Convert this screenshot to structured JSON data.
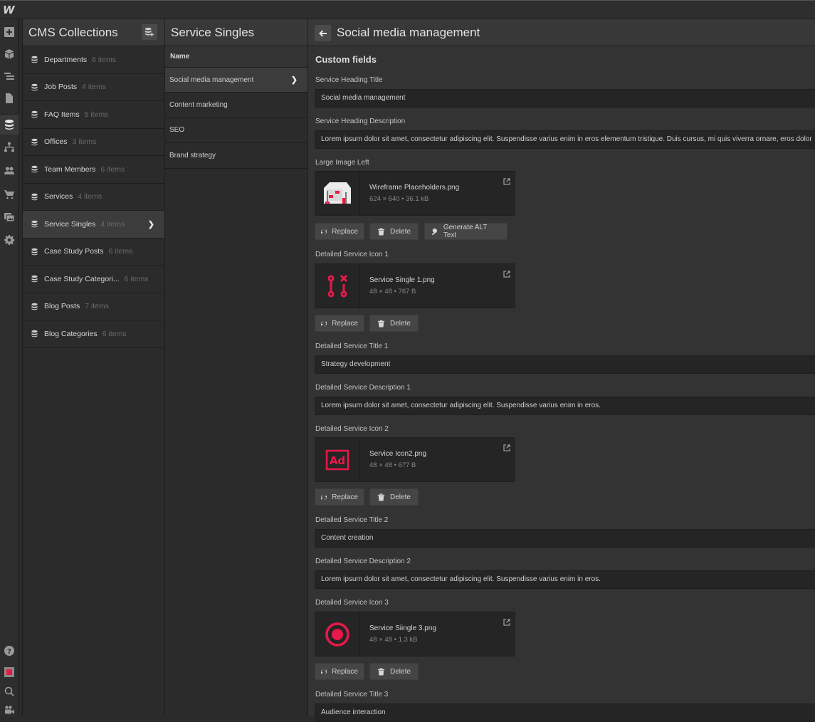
{
  "app": {
    "logo": "W"
  },
  "rail": {
    "icons": [
      "add-panel-icon",
      "components-icon",
      "navigator-icon",
      "pages-icon",
      "cms-icon",
      "logic-icon",
      "users-icon",
      "ecommerce-icon",
      "assets-icon",
      "settings-icon"
    ],
    "bottom_icons": [
      "help-icon",
      "record-icon",
      "search-icon",
      "video-icon"
    ]
  },
  "collections": {
    "title": "CMS Collections",
    "items": [
      {
        "name": "Departments",
        "count": "6 items"
      },
      {
        "name": "Job Posts",
        "count": "4 items"
      },
      {
        "name": "FAQ Items",
        "count": "5 items"
      },
      {
        "name": "Offices",
        "count": "3 items"
      },
      {
        "name": "Team Members",
        "count": "6 items"
      },
      {
        "name": "Services",
        "count": "4 items"
      },
      {
        "name": "Service Singles",
        "count": "4 items",
        "active": true
      },
      {
        "name": "Case Study Posts",
        "count": "6 items"
      },
      {
        "name": "Case Study Categori...",
        "count": "6 items"
      },
      {
        "name": "Blog Posts",
        "count": "7 items"
      },
      {
        "name": "Blog Categories",
        "count": "6 items"
      }
    ]
  },
  "entries": {
    "title": "Service Singles",
    "column_header": "Name",
    "items": [
      "Social media management",
      "Content marketing",
      "SEO",
      "Brand strategy"
    ]
  },
  "editor": {
    "title": "Social media management",
    "section": "Custom fields",
    "fields": {
      "heading_title": {
        "label": "Service Heading Title",
        "value": "Social media management"
      },
      "heading_desc": {
        "label": "Service Heading Description",
        "value": "Lorem ipsum dolor sit amet, consectetur adipiscing elit. Suspendisse varius enim in eros elementum tristique. Duis cursus, mi quis viverra ornare, eros dolor"
      },
      "large_image": {
        "label": "Large Image Left",
        "filename": "Wireframe Placeholders.png",
        "meta": "624 × 640 • 36.1 kB"
      },
      "icon1": {
        "label": "Detailed Service Icon 1",
        "filename": "Service Single 1.png",
        "meta": "48 × 48 • 767 B"
      },
      "title1": {
        "label": "Detailed Service Title 1",
        "value": "Strategy development"
      },
      "desc1": {
        "label": "Detailed Service Description 1",
        "value": "Lorem ipsum dolor sit amet, consectetur adipiscing elit. Suspendisse varius enim in eros."
      },
      "icon2": {
        "label": "Detailed Service Icon 2",
        "filename": "Service Icon2.png",
        "meta": "48 × 48 • 677 B"
      },
      "title2": {
        "label": "Detailed Service Title 2",
        "value": "Content creation"
      },
      "desc2": {
        "label": "Detailed Service Description 2",
        "value": "Lorem ipsum dolor sit amet, consectetur adipiscing elit. Suspendisse varius enim in eros."
      },
      "icon3": {
        "label": "Detailed Service Icon 3",
        "filename": "Service Siingle 3.png",
        "meta": "48 × 48 • 1.3 kB"
      },
      "title3": {
        "label": "Detailed Service Title 3",
        "value": "Audience interaction"
      }
    },
    "buttons": {
      "replace": "Replace",
      "delete": "Delete",
      "generate_alt": "Generate ALT Text"
    }
  },
  "colors": {
    "accent": "#e8194a",
    "panel": "#2b2b2b",
    "input": "#252525"
  }
}
